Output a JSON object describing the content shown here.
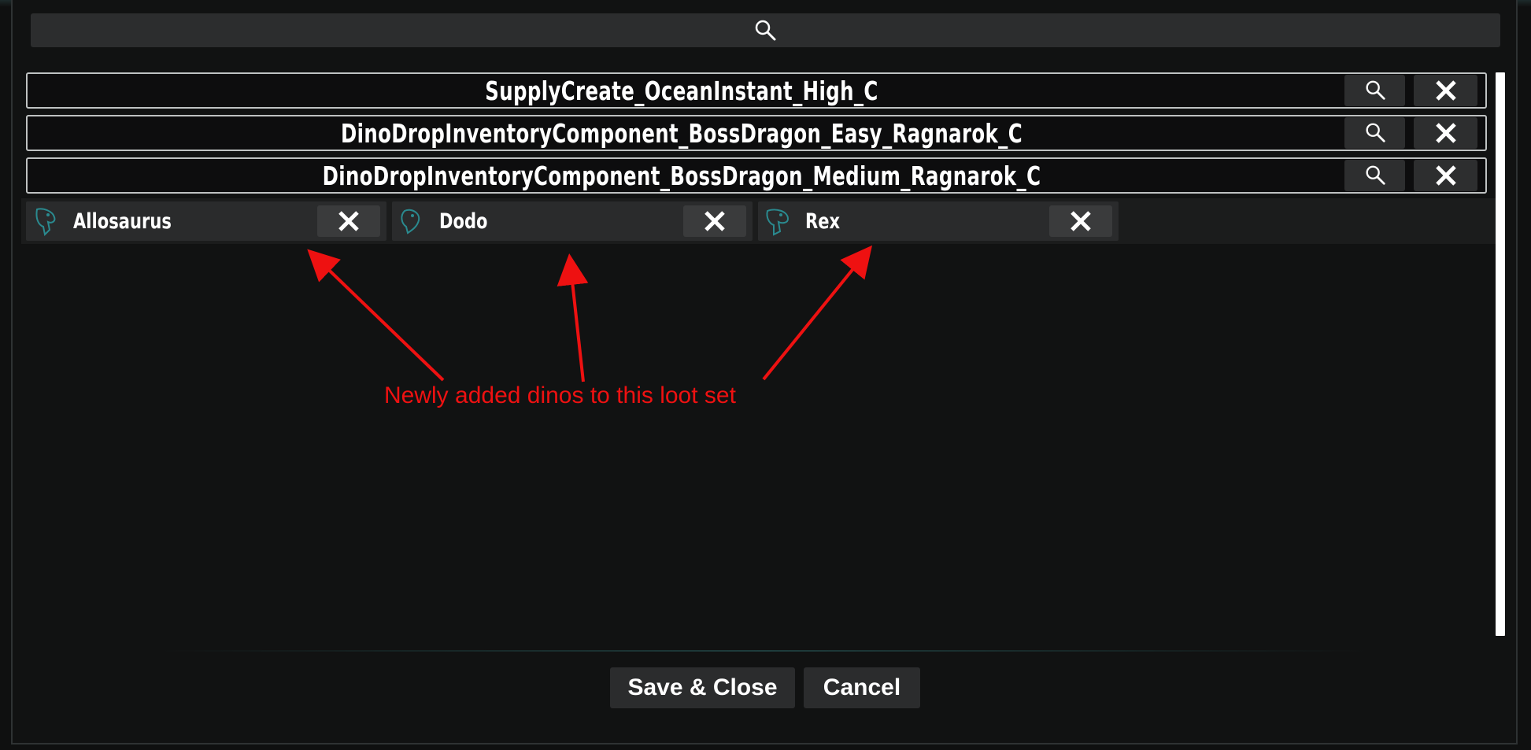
{
  "search": {
    "icon": "search-icon"
  },
  "loot_sets": [
    {
      "name": "SupplyCreate_OceanInstant_High_C"
    },
    {
      "name": "DinoDropInventoryComponent_BossDragon_Easy_Ragnarok_C"
    },
    {
      "name": "DinoDropInventoryComponent_BossDragon_Medium_Ragnarok_C"
    }
  ],
  "dinos": [
    {
      "name": "Allosaurus",
      "icon": "dino-head-icon"
    },
    {
      "name": "Dodo",
      "icon": "dino-head-icon"
    },
    {
      "name": "Rex",
      "icon": "dino-head-icon"
    }
  ],
  "annotation": {
    "text": "Newly added dinos to this loot set",
    "color": "#ee1111"
  },
  "footer": {
    "save_label": "Save & Close",
    "cancel_label": "Cancel"
  },
  "colors": {
    "row_border": "#bfc2c2",
    "button_bg": "#2d2e2f",
    "accent_dino": "#2a8a8f"
  }
}
